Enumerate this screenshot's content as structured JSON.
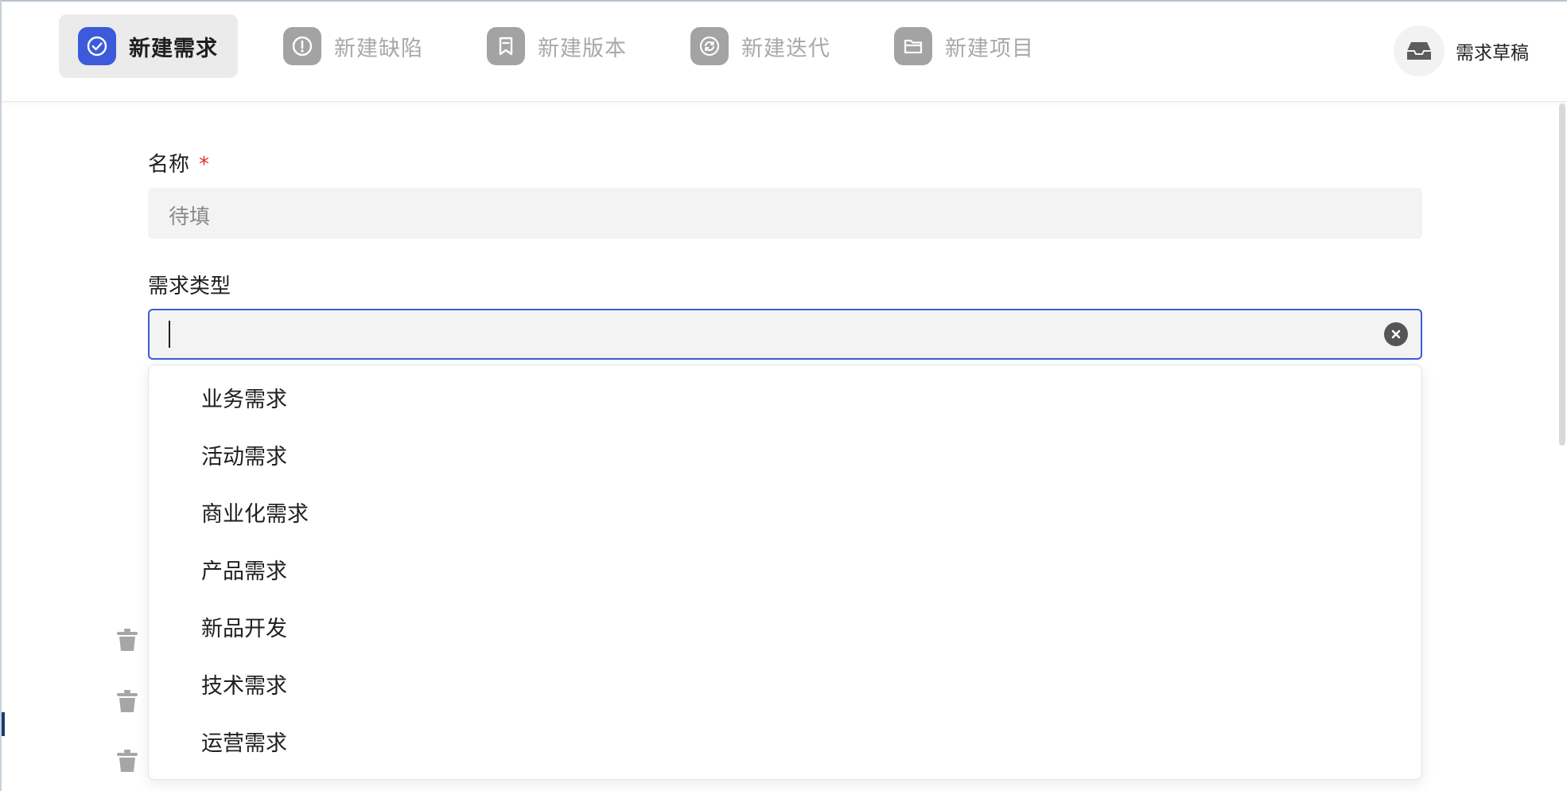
{
  "tabs": [
    {
      "label": "新建需求",
      "icon": "check-circle-icon",
      "active": true
    },
    {
      "label": "新建缺陷",
      "icon": "exclamation-circle-icon",
      "active": false
    },
    {
      "label": "新建版本",
      "icon": "bookmark-icon",
      "active": false
    },
    {
      "label": "新建迭代",
      "icon": "refresh-icon",
      "active": false
    },
    {
      "label": "新建项目",
      "icon": "folder-icon",
      "active": false
    }
  ],
  "draft": {
    "label": "需求草稿",
    "icon": "inbox-icon"
  },
  "form": {
    "name": {
      "label": "名称",
      "required_mark": "*",
      "placeholder": "待填"
    },
    "type": {
      "label": "需求类型",
      "value": ""
    }
  },
  "dropdown": {
    "options": [
      "业务需求",
      "活动需求",
      "商业化需求",
      "产品需求",
      "新品开发",
      "技术需求",
      "运营需求"
    ]
  },
  "colors": {
    "accent": "#3b5bdb",
    "required": "#e03131",
    "inactive_icon": "#a3a3a3",
    "active_tab_bg": "#ebebeb",
    "input_bg": "#f3f3f3"
  }
}
